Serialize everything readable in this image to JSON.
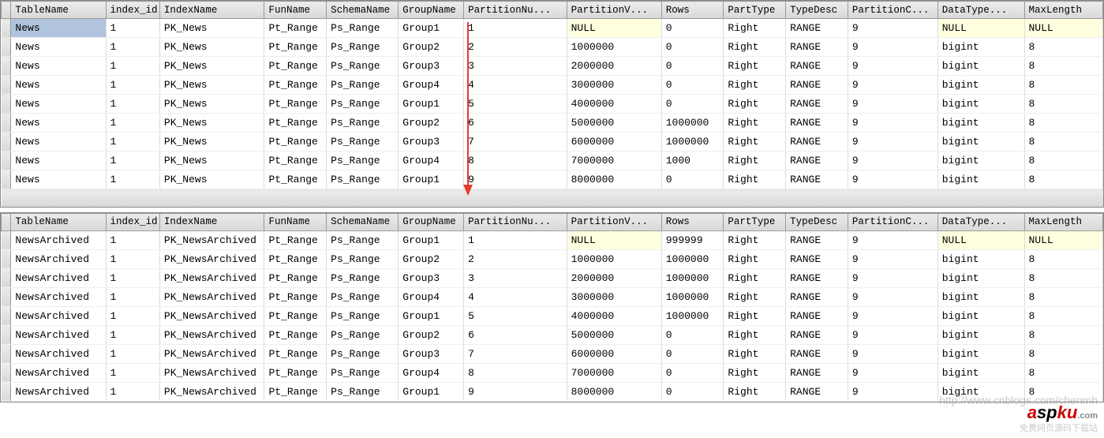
{
  "headers": {
    "rowsel": "",
    "tableName": "TableName",
    "index_id": "index_id",
    "indexName": "IndexName",
    "funName": "FunName",
    "schemaName": "SchemaName",
    "groupName": "GroupName",
    "partitionNu": "PartitionNu...",
    "partitionV": "PartitionV...",
    "rows": "Rows",
    "partType": "PartType",
    "typeDesc": "TypeDesc",
    "partitionC": "PartitionC...",
    "dataType": "DataType...",
    "maxLength": "MaxLength"
  },
  "table1": {
    "rows": [
      {
        "TableName": "News",
        "index_id": "1",
        "IndexName": "PK_News",
        "FunName": "Pt_Range",
        "SchemaName": "Ps_Range",
        "GroupName": "Group1",
        "PartitionNu": "1",
        "PartitionV": "NULL",
        "Rows": "0",
        "PartType": "Right",
        "TypeDesc": "RANGE",
        "PartitionC": "9",
        "DataType": "NULL",
        "MaxLength": "NULL"
      },
      {
        "TableName": "News",
        "index_id": "1",
        "IndexName": "PK_News",
        "FunName": "Pt_Range",
        "SchemaName": "Ps_Range",
        "GroupName": "Group2",
        "PartitionNu": "2",
        "PartitionV": "1000000",
        "Rows": "0",
        "PartType": "Right",
        "TypeDesc": "RANGE",
        "PartitionC": "9",
        "DataType": "bigint",
        "MaxLength": "8"
      },
      {
        "TableName": "News",
        "index_id": "1",
        "IndexName": "PK_News",
        "FunName": "Pt_Range",
        "SchemaName": "Ps_Range",
        "GroupName": "Group3",
        "PartitionNu": "3",
        "PartitionV": "2000000",
        "Rows": "0",
        "PartType": "Right",
        "TypeDesc": "RANGE",
        "PartitionC": "9",
        "DataType": "bigint",
        "MaxLength": "8"
      },
      {
        "TableName": "News",
        "index_id": "1",
        "IndexName": "PK_News",
        "FunName": "Pt_Range",
        "SchemaName": "Ps_Range",
        "GroupName": "Group4",
        "PartitionNu": "4",
        "PartitionV": "3000000",
        "Rows": "0",
        "PartType": "Right",
        "TypeDesc": "RANGE",
        "PartitionC": "9",
        "DataType": "bigint",
        "MaxLength": "8"
      },
      {
        "TableName": "News",
        "index_id": "1",
        "IndexName": "PK_News",
        "FunName": "Pt_Range",
        "SchemaName": "Ps_Range",
        "GroupName": "Group1",
        "PartitionNu": "5",
        "PartitionV": "4000000",
        "Rows": "0",
        "PartType": "Right",
        "TypeDesc": "RANGE",
        "PartitionC": "9",
        "DataType": "bigint",
        "MaxLength": "8"
      },
      {
        "TableName": "News",
        "index_id": "1",
        "IndexName": "PK_News",
        "FunName": "Pt_Range",
        "SchemaName": "Ps_Range",
        "GroupName": "Group2",
        "PartitionNu": "6",
        "PartitionV": "5000000",
        "Rows": "1000000",
        "PartType": "Right",
        "TypeDesc": "RANGE",
        "PartitionC": "9",
        "DataType": "bigint",
        "MaxLength": "8"
      },
      {
        "TableName": "News",
        "index_id": "1",
        "IndexName": "PK_News",
        "FunName": "Pt_Range",
        "SchemaName": "Ps_Range",
        "GroupName": "Group3",
        "PartitionNu": "7",
        "PartitionV": "6000000",
        "Rows": "1000000",
        "PartType": "Right",
        "TypeDesc": "RANGE",
        "PartitionC": "9",
        "DataType": "bigint",
        "MaxLength": "8"
      },
      {
        "TableName": "News",
        "index_id": "1",
        "IndexName": "PK_News",
        "FunName": "Pt_Range",
        "SchemaName": "Ps_Range",
        "GroupName": "Group4",
        "PartitionNu": "8",
        "PartitionV": "7000000",
        "Rows": "1000",
        "PartType": "Right",
        "TypeDesc": "RANGE",
        "PartitionC": "9",
        "DataType": "bigint",
        "MaxLength": "8"
      },
      {
        "TableName": "News",
        "index_id": "1",
        "IndexName": "PK_News",
        "FunName": "Pt_Range",
        "SchemaName": "Ps_Range",
        "GroupName": "Group1",
        "PartitionNu": "9",
        "PartitionV": "8000000",
        "Rows": "0",
        "PartType": "Right",
        "TypeDesc": "RANGE",
        "PartitionC": "9",
        "DataType": "bigint",
        "MaxLength": "8"
      }
    ]
  },
  "table2": {
    "rows": [
      {
        "TableName": "NewsArchived",
        "index_id": "1",
        "IndexName": "PK_NewsArchived",
        "FunName": "Pt_Range",
        "SchemaName": "Ps_Range",
        "GroupName": "Group1",
        "PartitionNu": "1",
        "PartitionV": "NULL",
        "Rows": "999999",
        "PartType": "Right",
        "TypeDesc": "RANGE",
        "PartitionC": "9",
        "DataType": "NULL",
        "MaxLength": "NULL"
      },
      {
        "TableName": "NewsArchived",
        "index_id": "1",
        "IndexName": "PK_NewsArchived",
        "FunName": "Pt_Range",
        "SchemaName": "Ps_Range",
        "GroupName": "Group2",
        "PartitionNu": "2",
        "PartitionV": "1000000",
        "Rows": "1000000",
        "PartType": "Right",
        "TypeDesc": "RANGE",
        "PartitionC": "9",
        "DataType": "bigint",
        "MaxLength": "8"
      },
      {
        "TableName": "NewsArchived",
        "index_id": "1",
        "IndexName": "PK_NewsArchived",
        "FunName": "Pt_Range",
        "SchemaName": "Ps_Range",
        "GroupName": "Group3",
        "PartitionNu": "3",
        "PartitionV": "2000000",
        "Rows": "1000000",
        "PartType": "Right",
        "TypeDesc": "RANGE",
        "PartitionC": "9",
        "DataType": "bigint",
        "MaxLength": "8"
      },
      {
        "TableName": "NewsArchived",
        "index_id": "1",
        "IndexName": "PK_NewsArchived",
        "FunName": "Pt_Range",
        "SchemaName": "Ps_Range",
        "GroupName": "Group4",
        "PartitionNu": "4",
        "PartitionV": "3000000",
        "Rows": "1000000",
        "PartType": "Right",
        "TypeDesc": "RANGE",
        "PartitionC": "9",
        "DataType": "bigint",
        "MaxLength": "8"
      },
      {
        "TableName": "NewsArchived",
        "index_id": "1",
        "IndexName": "PK_NewsArchived",
        "FunName": "Pt_Range",
        "SchemaName": "Ps_Range",
        "GroupName": "Group1",
        "PartitionNu": "5",
        "PartitionV": "4000000",
        "Rows": "1000000",
        "PartType": "Right",
        "TypeDesc": "RANGE",
        "PartitionC": "9",
        "DataType": "bigint",
        "MaxLength": "8"
      },
      {
        "TableName": "NewsArchived",
        "index_id": "1",
        "IndexName": "PK_NewsArchived",
        "FunName": "Pt_Range",
        "SchemaName": "Ps_Range",
        "GroupName": "Group2",
        "PartitionNu": "6",
        "PartitionV": "5000000",
        "Rows": "0",
        "PartType": "Right",
        "TypeDesc": "RANGE",
        "PartitionC": "9",
        "DataType": "bigint",
        "MaxLength": "8"
      },
      {
        "TableName": "NewsArchived",
        "index_id": "1",
        "IndexName": "PK_NewsArchived",
        "FunName": "Pt_Range",
        "SchemaName": "Ps_Range",
        "GroupName": "Group3",
        "PartitionNu": "7",
        "PartitionV": "6000000",
        "Rows": "0",
        "PartType": "Right",
        "TypeDesc": "RANGE",
        "PartitionC": "9",
        "DataType": "bigint",
        "MaxLength": "8"
      },
      {
        "TableName": "NewsArchived",
        "index_id": "1",
        "IndexName": "PK_NewsArchived",
        "FunName": "Pt_Range",
        "SchemaName": "Ps_Range",
        "GroupName": "Group4",
        "PartitionNu": "8",
        "PartitionV": "7000000",
        "Rows": "0",
        "PartType": "Right",
        "TypeDesc": "RANGE",
        "PartitionC": "9",
        "DataType": "bigint",
        "MaxLength": "8"
      },
      {
        "TableName": "NewsArchived",
        "index_id": "1",
        "IndexName": "PK_NewsArchived",
        "FunName": "Pt_Range",
        "SchemaName": "Ps_Range",
        "GroupName": "Group1",
        "PartitionNu": "9",
        "PartitionV": "8000000",
        "Rows": "0",
        "PartType": "Right",
        "TypeDesc": "RANGE",
        "PartitionC": "9",
        "DataType": "bigint",
        "MaxLength": "8"
      }
    ]
  },
  "watermark": {
    "url": "http://www.cnblogs.com/chenmh",
    "tag": "免费网页源码下载站"
  }
}
